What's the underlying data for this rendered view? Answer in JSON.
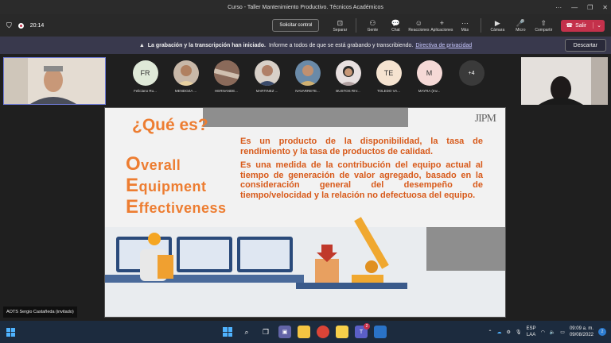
{
  "window": {
    "title": "Curso - Taller Mantenimiento Productivo. Técnicos Académicos",
    "controls": {
      "more": "···",
      "minimize": "—",
      "restore": "❐",
      "close": "✕"
    }
  },
  "toolbar": {
    "timer": "20:14",
    "request_control": "Solicitar control",
    "buttons": [
      {
        "icon": "⊡",
        "label": "Separar"
      },
      {
        "icon": "⚇",
        "label": "Gente"
      },
      {
        "icon": "💬",
        "label": "Chat"
      },
      {
        "icon": "☺",
        "label": "Reacciones"
      },
      {
        "icon": "+",
        "label": "Aplicaciones"
      },
      {
        "icon": "···",
        "label": "Más"
      },
      {
        "icon": "▶",
        "label": "Cámara"
      },
      {
        "icon": "🎤",
        "label": "Micro"
      },
      {
        "icon": "⇧",
        "label": "Compartir"
      }
    ],
    "leave": "Salir"
  },
  "banner": {
    "bold": "La grabación y la transcripción han iniciado.",
    "text": "Informe a todos de que se está grabando y transcribiendo.",
    "link": "Directiva de privacidad",
    "dismiss": "Descartar"
  },
  "participants": [
    {
      "initials": "FR",
      "name": "Feliciano Ru...",
      "color": "#dfe9d8"
    },
    {
      "initials": "",
      "name": "MENDOZA ...",
      "color": "#c8b8a8"
    },
    {
      "initials": "",
      "name": "HERNANDE...",
      "color": "#a08070"
    },
    {
      "initials": "",
      "name": "MARTINEZ ...",
      "color": "#d8d0c8"
    },
    {
      "initials": "",
      "name": "NAVARRETE...",
      "color": "#6a8aa8"
    },
    {
      "initials": "",
      "name": "BUSTOS RIV...",
      "color": "#e8e0e0"
    },
    {
      "initials": "TE",
      "name": "TOLEDO VA...",
      "color": "#f5e3d0"
    },
    {
      "initials": "M",
      "name": "MAYRA (Inv...",
      "color": "#f5d9d6"
    }
  ],
  "more_participants": "+4",
  "slide": {
    "title": "¿Qué es?",
    "oee": [
      {
        "cap": "O",
        "rest": "verall"
      },
      {
        "cap": "E",
        "rest": "quipment"
      },
      {
        "cap": "E",
        "rest": "ffectiveness"
      }
    ],
    "paragraph1": "Es un producto de la disponibilidad, la tasa de rendimiento y la tasa de productos de calidad.",
    "paragraph2": "Es una medida de la contribución del equipo actual al tiempo de generación de valor agregado, basado en la consideración general del desempeño de tiempo/velocidad y la relación no defectuosa del equipo.",
    "logo": "JIPM"
  },
  "presenter_name": "AOTS Sergio Castañeda (invitado)",
  "taskbar": {
    "lang_top": "ESP",
    "lang_bottom": "LAA",
    "time": "09:09 a. m.",
    "date": "09/08/2022",
    "notifications": "2",
    "teams_badge": "2"
  }
}
